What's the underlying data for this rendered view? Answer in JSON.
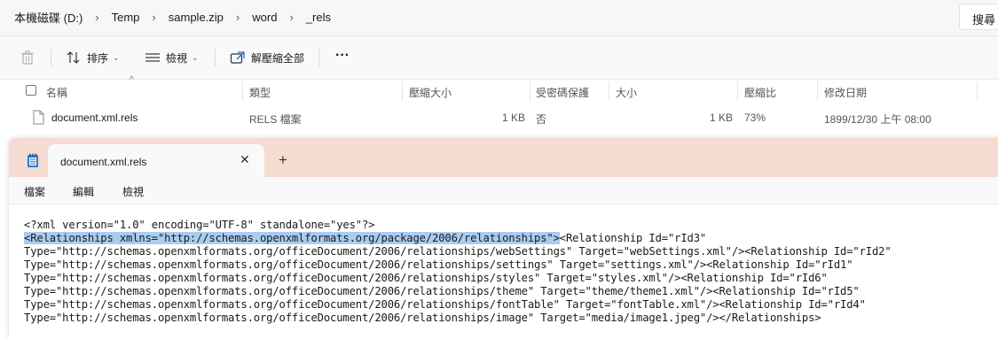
{
  "address": {
    "crumbs": [
      "本機磁碟 (D:)",
      "Temp",
      "sample.zip",
      "word",
      "_rels"
    ],
    "search_label": "搜尋"
  },
  "toolbar": {
    "sort_label": "排序",
    "view_label": "檢視",
    "extract_label": "解壓縮全部",
    "more_label": "···"
  },
  "columns": {
    "name": "名稱",
    "type": "類型",
    "compressed_size": "壓縮大小",
    "password": "受密碼保護",
    "size": "大小",
    "ratio": "壓縮比",
    "modified": "修改日期"
  },
  "files": [
    {
      "name": "document.xml.rels",
      "type": "RELS 檔案",
      "compressed_size": "1 KB",
      "password": "否",
      "size": "1 KB",
      "ratio": "73%",
      "modified": "1899/12/30 上午 08:00"
    }
  ],
  "notepad": {
    "tab_title": "document.xml.rels",
    "new_tab": "+",
    "close": "✕",
    "menu": {
      "file": "檔案",
      "edit": "編輯",
      "view": "檢視"
    },
    "lines": [
      "<?xml version=\"1.0\" encoding=\"UTF-8\" standalone=\"yes\"?>",
      "",
      "Type=\"http://schemas.openxmlformats.org/officeDocument/2006/relationships/webSettings\" Target=\"webSettings.xml\"/><Relationship Id=\"rId2\"",
      "Type=\"http://schemas.openxmlformats.org/officeDocument/2006/relationships/settings\" Target=\"settings.xml\"/><Relationship Id=\"rId1\"",
      "Type=\"http://schemas.openxmlformats.org/officeDocument/2006/relationships/styles\" Target=\"styles.xml\"/><Relationship Id=\"rId6\"",
      "Type=\"http://schemas.openxmlformats.org/officeDocument/2006/relationships/theme\" Target=\"theme/theme1.xml\"/><Relationship Id=\"rId5\"",
      "Type=\"http://schemas.openxmlformats.org/officeDocument/2006/relationships/fontTable\" Target=\"fontTable.xml\"/><Relationship Id=\"rId4\"",
      "Type=\"http://schemas.openxmlformats.org/officeDocument/2006/relationships/image\" Target=\"media/image1.jpeg\"/></Relationships>"
    ],
    "line2_selected": "<Relationships xmlns=\"http://schemas.openxmlformats.org/package/2006/relationships\">",
    "line2_rest": "<Relationship Id=\"rId3\"",
    "selection_color": "#a9cdf0"
  }
}
